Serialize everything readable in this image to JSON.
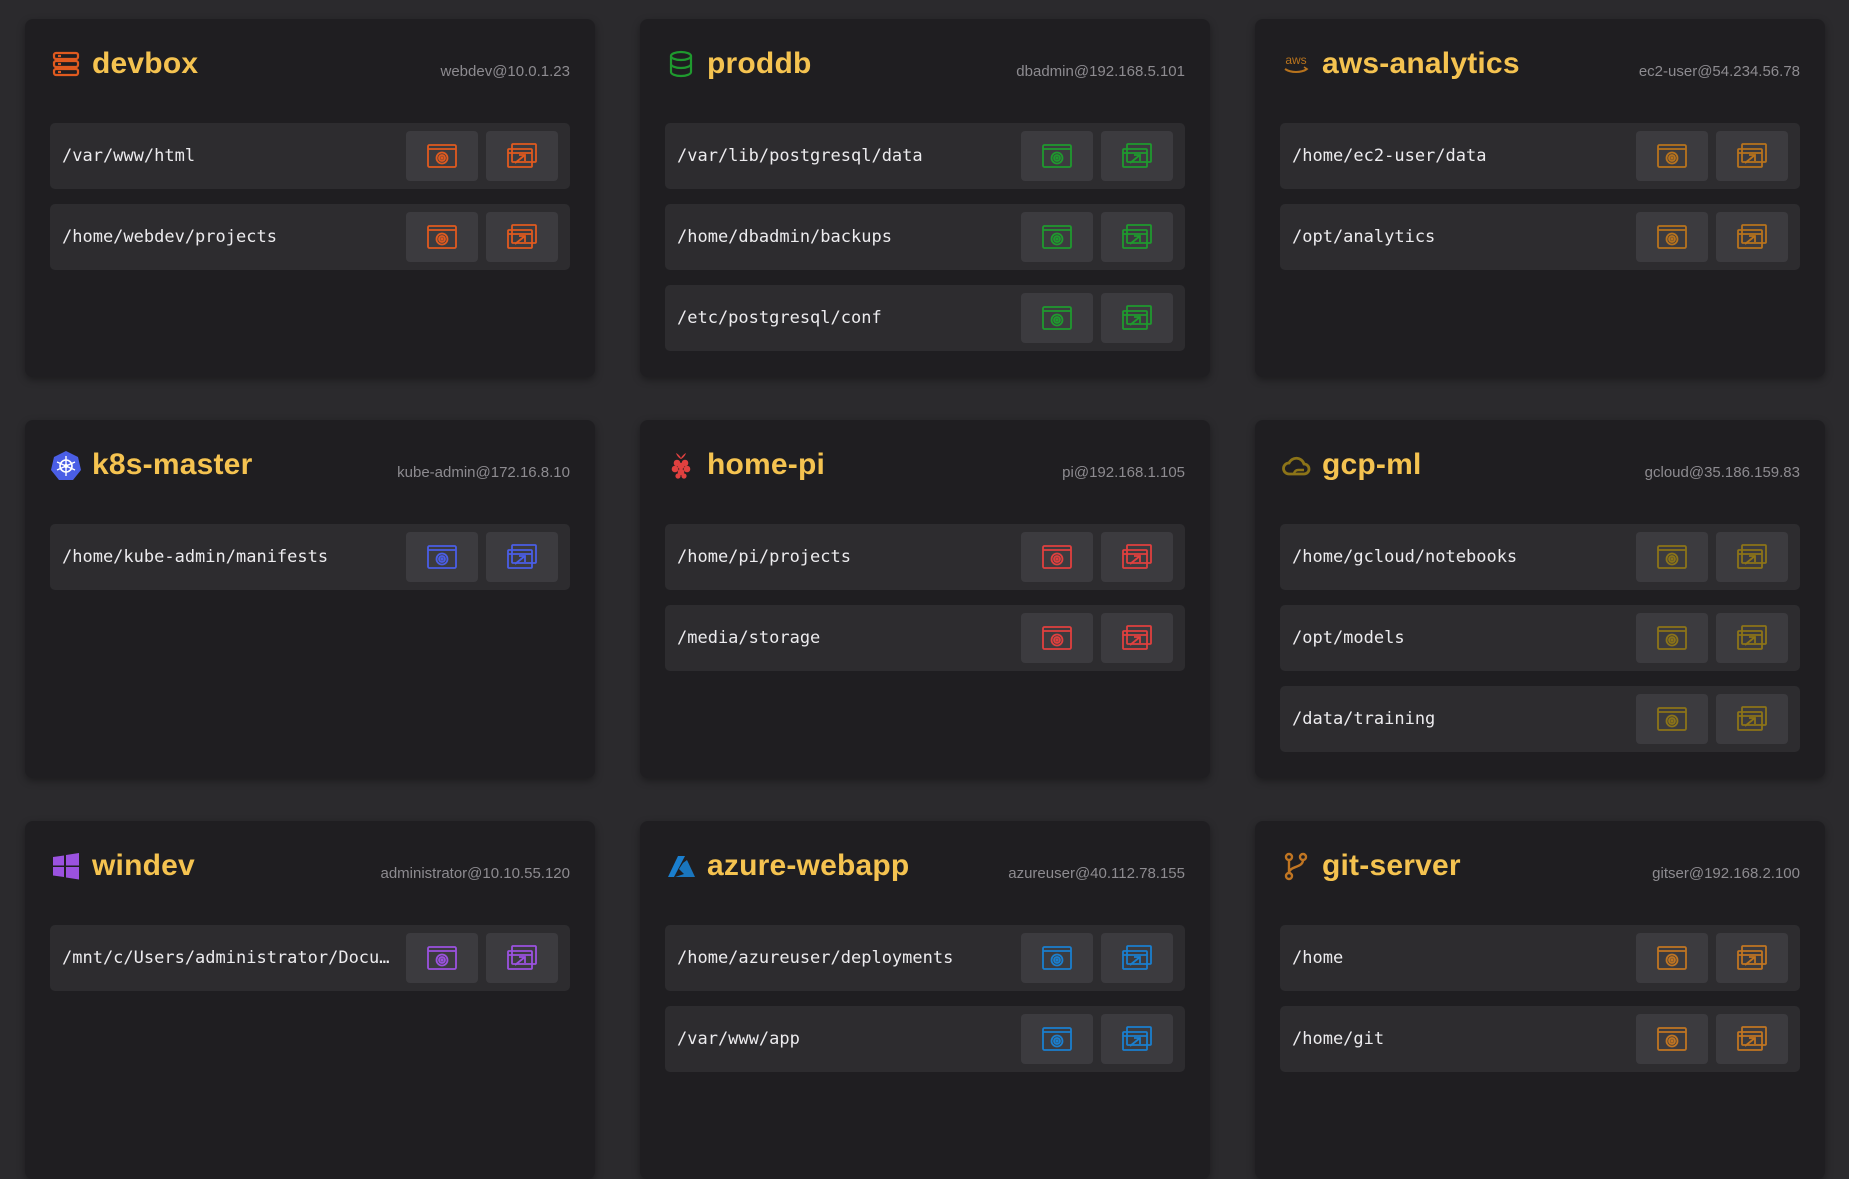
{
  "hosts": [
    {
      "name": "devbox",
      "connection": "webdev@10.0.1.23",
      "icon": "server-stack-icon",
      "color": "#e05a1f",
      "paths": [
        "/var/www/html",
        "/home/webdev/projects"
      ]
    },
    {
      "name": "proddb",
      "connection": "dbadmin@192.168.5.101",
      "icon": "database-icon",
      "color": "#1f9a2e",
      "paths": [
        "/var/lib/postgresql/data",
        "/home/dbadmin/backups",
        "/etc/postgresql/conf"
      ]
    },
    {
      "name": "aws-analytics",
      "connection": "ec2-user@54.234.56.78",
      "icon": "aws-logo-icon",
      "color": "#b8731d",
      "logo_text": "aws",
      "paths": [
        "/home/ec2-user/data",
        "/opt/analytics"
      ]
    },
    {
      "name": "k8s-master",
      "connection": "kube-admin@172.16.8.10",
      "icon": "kubernetes-helm-icon",
      "color": "#4a5ee6",
      "paths": [
        "/home/kube-admin/manifests"
      ]
    },
    {
      "name": "home-pi",
      "connection": "pi@192.168.1.105",
      "icon": "raspberry-pi-icon",
      "color": "#e0403f",
      "paths": [
        "/home/pi/projects",
        "/media/storage"
      ]
    },
    {
      "name": "gcp-ml",
      "connection": "gcloud@35.186.159.83",
      "icon": "cloud-icon",
      "color": "#8c7418",
      "paths": [
        "/home/gcloud/notebooks",
        "/opt/models",
        "/data/training"
      ]
    },
    {
      "name": "windev",
      "connection": "administrator@10.10.55.120",
      "icon": "windows-logo-icon",
      "color": "#9b52e0",
      "paths": [
        "/mnt/c/Users/administrator/Docume…"
      ]
    },
    {
      "name": "azure-webapp",
      "connection": "azureuser@40.112.78.155",
      "icon": "azure-logo-icon",
      "color": "#1a7fcf",
      "paths": [
        "/home/azureuser/deployments",
        "/var/www/app"
      ]
    },
    {
      "name": "git-server",
      "connection": "gitser@192.168.2.100",
      "icon": "git-branch-icon",
      "color": "#c07522",
      "paths": [
        "/home",
        "/home/git"
      ]
    }
  ],
  "actions": {
    "open_icon": "terminal-window-icon",
    "external_icon": "open-external-window-icon"
  }
}
